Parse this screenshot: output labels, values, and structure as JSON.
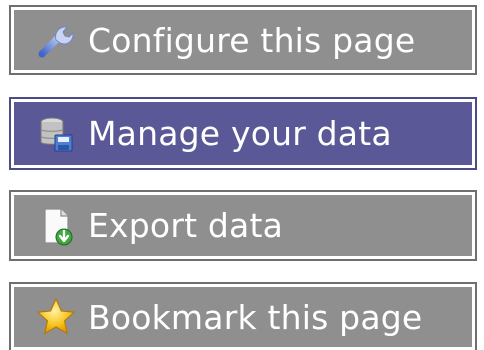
{
  "menu": {
    "items": [
      {
        "label": "Configure this page",
        "icon": "wrench-icon",
        "active": false
      },
      {
        "label": "Manage your data",
        "icon": "database-icon",
        "active": true
      },
      {
        "label": "Export data",
        "icon": "export-document-icon",
        "active": false
      },
      {
        "label": "Bookmark this page",
        "icon": "star-icon",
        "active": false
      }
    ]
  },
  "colors": {
    "button_bg": "#8f8f8f",
    "button_active_bg": "#5a5896",
    "button_text": "#ffffff"
  }
}
